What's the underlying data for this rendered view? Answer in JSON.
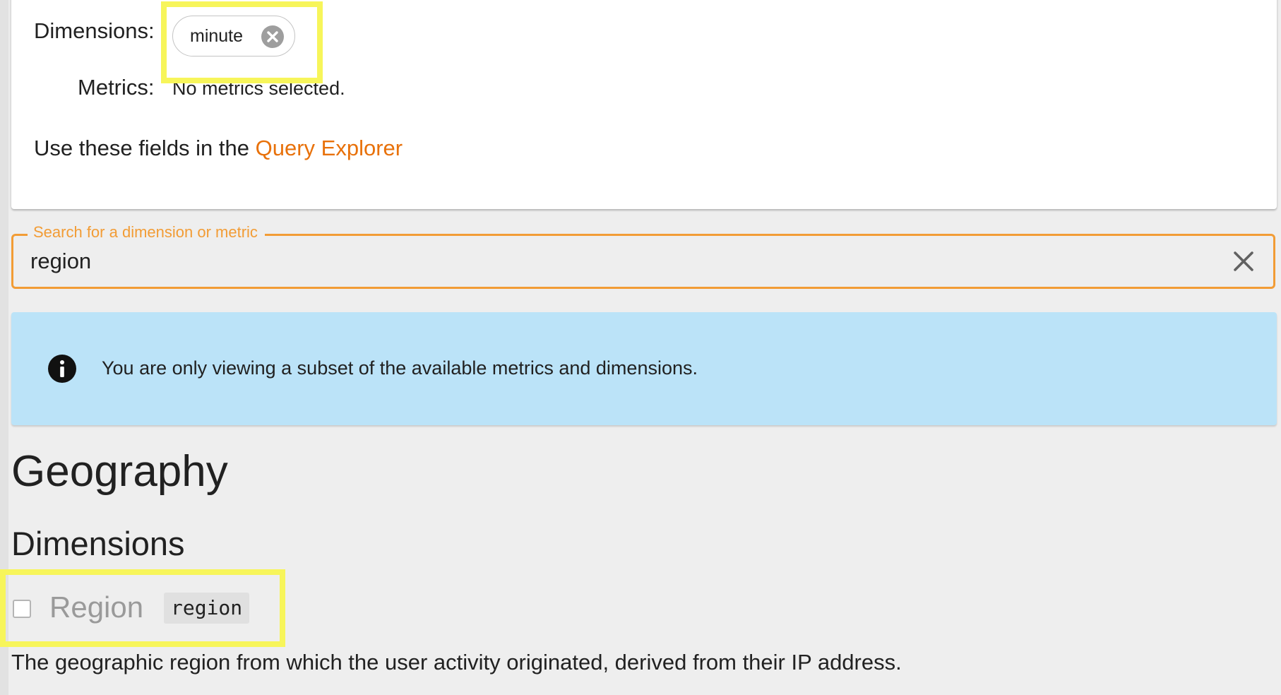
{
  "selection": {
    "dimensions_label": "Dimensions:",
    "dimension_chips": [
      {
        "label": "minute"
      }
    ],
    "metrics_label": "Metrics:",
    "metrics_value": "No metrics selected.",
    "use_fields_prefix": "Use these fields in the",
    "query_explorer_link": "Query Explorer"
  },
  "search": {
    "label": "Search for a dimension or metric",
    "value": "region",
    "clear_icon": "close-icon"
  },
  "info_banner": {
    "icon": "info-icon",
    "text": "You are only viewing a subset of the available metrics and dimensions."
  },
  "results": {
    "category_title": "Geography",
    "section_title": "Dimensions",
    "fields": [
      {
        "name": "Region",
        "api_name": "region",
        "checked": false,
        "description": "The geographic region from which the user activity originated, derived from their IP address."
      }
    ]
  },
  "colors": {
    "accent_orange": "#f29c35",
    "link_orange": "#e8710a",
    "info_background": "#bbe3f8",
    "highlight_yellow": "#f7f55a",
    "page_background": "#eeeeee"
  }
}
